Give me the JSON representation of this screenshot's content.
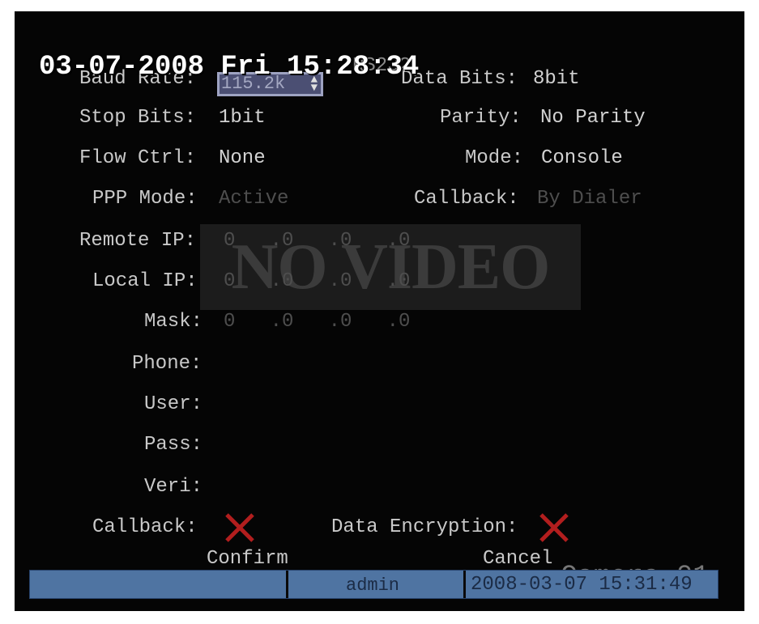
{
  "osd": {
    "datetime": "03-07-2008 Fri 15:28:34",
    "camera": "Camera 01"
  },
  "menu": {
    "title": "RS232"
  },
  "fields": {
    "baud_rate": {
      "label": "Baud Rate:",
      "value": "115.2k"
    },
    "data_bits": {
      "label": "Data Bits:",
      "value": "8bit"
    },
    "stop_bits": {
      "label": "Stop Bits:",
      "value": "1bit"
    },
    "parity": {
      "label": "Parity:",
      "value": "No Parity"
    },
    "flow_ctrl": {
      "label": "Flow Ctrl:",
      "value": "None"
    },
    "mode": {
      "label": "Mode:",
      "value": "Console"
    },
    "ppp_mode": {
      "label": "PPP Mode:",
      "value": "Active"
    },
    "callback_top": {
      "label": "Callback:",
      "value": "By Dialer"
    },
    "remote_ip": {
      "label": "Remote IP:",
      "value": "0   .0   .0   .0"
    },
    "local_ip": {
      "label": "Local IP:",
      "value": "0   .0   .0   .0"
    },
    "mask": {
      "label": "Mask:",
      "value": "0   .0   .0   .0"
    },
    "phone": {
      "label": "Phone:"
    },
    "user": {
      "label": "User:"
    },
    "pass": {
      "label": "Pass:"
    },
    "veri": {
      "label": "Veri:"
    },
    "callback": {
      "label": "Callback:",
      "icon": "red-x-icon"
    },
    "data_encryption": {
      "label": "Data Encryption:",
      "icon": "red-x-icon"
    }
  },
  "buttons": {
    "confirm": "Confirm",
    "cancel": "Cancel"
  },
  "overlay": {
    "no_video": "NO VIDEO"
  },
  "status_bar": {
    "user": "admin",
    "timestamp": "2008-03-07 15:31:49"
  },
  "colors": {
    "status_bar": "#4f74a2",
    "x_mark": "#b21e1e",
    "selected_field": "#4b4f73"
  }
}
